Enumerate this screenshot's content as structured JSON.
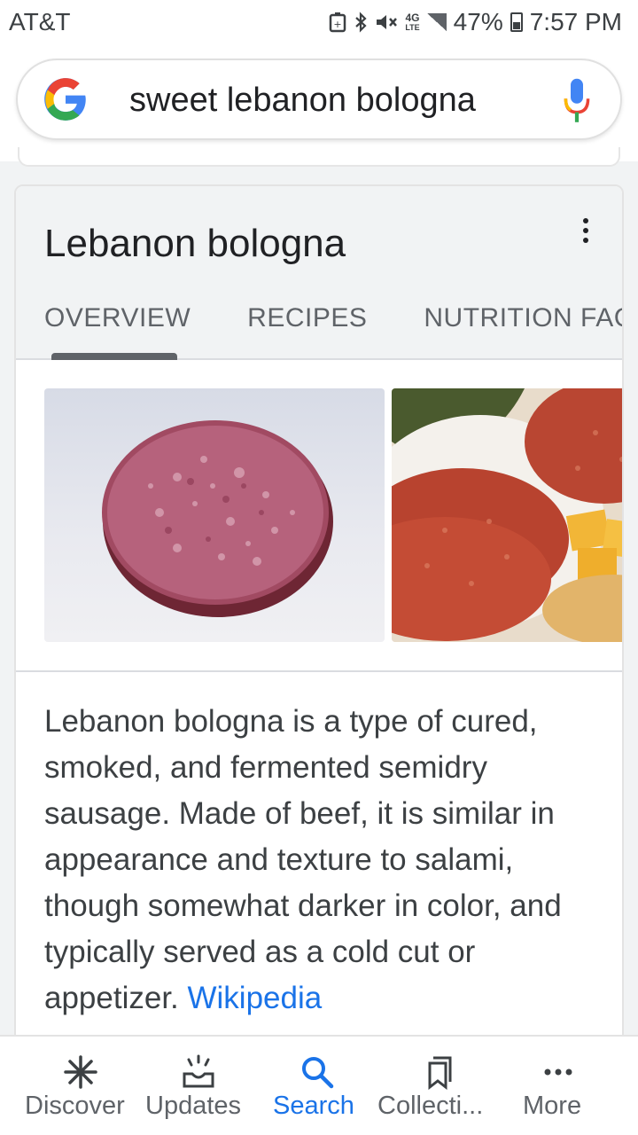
{
  "status_bar": {
    "carrier": "AT&T",
    "network": "4G",
    "network_sub": "LTE",
    "battery": "47%",
    "time": "7:57 PM",
    "icons": [
      "data-saver-icon",
      "bluetooth-icon",
      "mute-icon",
      "network-icon",
      "signal-icon",
      "battery-icon"
    ]
  },
  "search": {
    "query": "sweet lebanon bologna"
  },
  "knowledge_card": {
    "title": "Lebanon bologna",
    "tabs": [
      {
        "label": "OVERVIEW",
        "active": true
      },
      {
        "label": "RECIPES",
        "active": false
      },
      {
        "label": "NUTRITION FACT",
        "active": false
      }
    ],
    "description": "Lebanon bologna is a type of cured, smoked, and fermented semidry sausage. Made of beef, it is similar in appearance and texture to salami, though somewhat darker in color, and typically served as a cold cut or appetizer.",
    "source_link": "Wikipedia"
  },
  "bottom_nav": [
    {
      "label": "Discover",
      "icon": "asterisk-icon",
      "active": false
    },
    {
      "label": "Updates",
      "icon": "updates-icon",
      "active": false
    },
    {
      "label": "Search",
      "icon": "search-icon",
      "active": true
    },
    {
      "label": "Collecti...",
      "icon": "bookmark-icon",
      "active": false
    },
    {
      "label": "More",
      "icon": "more-dots-icon",
      "active": false
    }
  ],
  "colors": {
    "accent": "#1a73e8",
    "text": "#202124",
    "secondary_text": "#5f6368",
    "header_bg": "#f1f3f4"
  }
}
